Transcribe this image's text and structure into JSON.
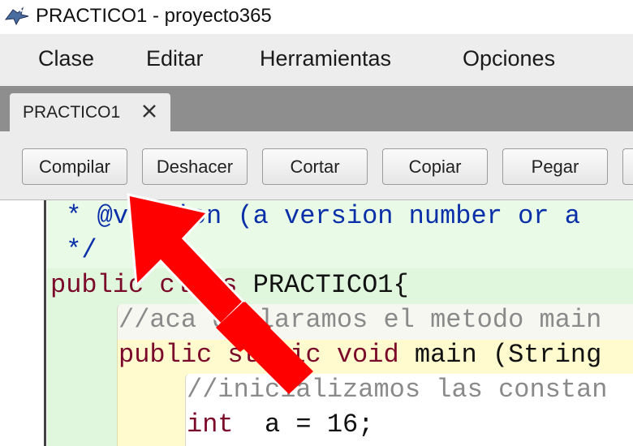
{
  "window": {
    "title": "PRACTICO1 - proyecto365"
  },
  "menu": {
    "items": [
      "Clase",
      "Editar",
      "Herramientas",
      "Opciones"
    ]
  },
  "tabs": {
    "active": {
      "label": "PRACTICO1",
      "close_glyph": "✕"
    }
  },
  "toolbar": {
    "buttons": [
      "Compilar",
      "Deshacer",
      "Cortar",
      "Copiar",
      "Pegar"
    ]
  },
  "editor": {
    "lines": {
      "doc_version": " * @version (a version number or a",
      "doc_end": " */",
      "class_kw": "public class",
      "class_name": " PRACTICO1{",
      "comment_main": "//aca declaramos el metodo main",
      "method_kw1": "public static ",
      "method_kw2": "void",
      "method_rest": " main (String",
      "comment_init": "//inicializamos las constan",
      "int_kw": "int",
      "int_rest": "  a = 16;"
    }
  },
  "colors": {
    "arrow": "#ff0000",
    "doc_comment": "#0a2fa8",
    "keyword": "#7b0a2a",
    "comment": "#8a8a8a"
  }
}
